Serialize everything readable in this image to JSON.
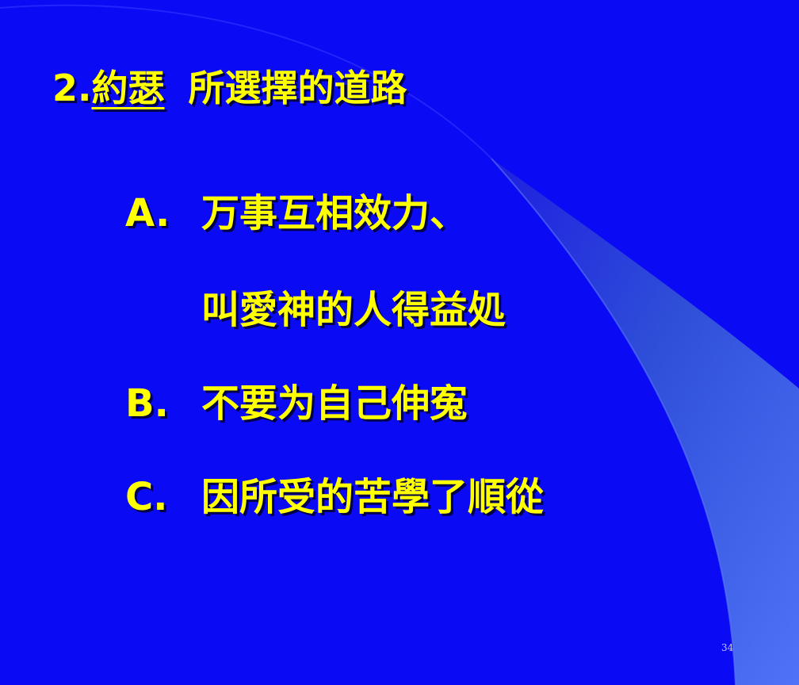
{
  "slide": {
    "title": {
      "number": "2.",
      "name": "約瑟",
      "rest": "所選擇的道路"
    },
    "points": [
      {
        "marker": "A.",
        "lines": [
          "万事互相效力、",
          "叫愛神的人得益処"
        ]
      },
      {
        "marker": "B.",
        "lines": [
          "不要为自己伸寃"
        ]
      },
      {
        "marker": "C.",
        "lines": [
          "因所受的苦學了順從"
        ]
      }
    ],
    "page_number": "34"
  },
  "colors": {
    "background": "#0a0af5",
    "text": "#ffff00",
    "swoosh_light": "#4a6cf0",
    "swoosh_dark": "#2424c8"
  }
}
